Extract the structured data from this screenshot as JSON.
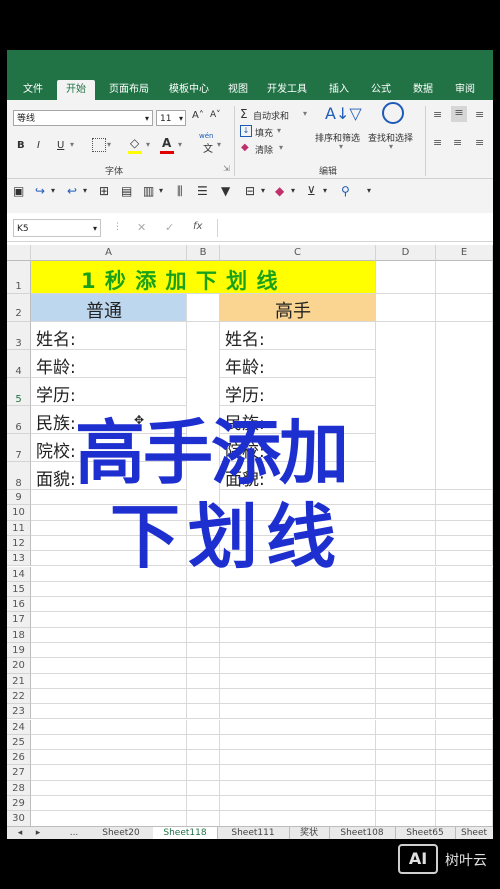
{
  "ribbon_tabs": [
    "文件",
    "开始",
    "页面布局",
    "模板中心",
    "视图",
    "开发工具",
    "插入",
    "公式",
    "数据",
    "审阅"
  ],
  "active_tab": "开始",
  "font": {
    "name": "等线",
    "size": "11",
    "grow": "A˄",
    "shrink": "A˅",
    "bold": "B",
    "italic": "I",
    "underline": "U",
    "group_label": "字体",
    "color_a": "A",
    "wen": "wén",
    "wen_char": "文"
  },
  "editing": {
    "autosum": "自动求和",
    "fill": "填充",
    "clear": "清除",
    "sort_filter": "排序和筛选",
    "find_select": "查找和选择",
    "group_label": "编辑"
  },
  "name_box": "K5",
  "formula_icons": {
    "cancel": "✕",
    "confirm": "✓",
    "fx": "fx"
  },
  "columns": [
    "A",
    "B",
    "C",
    "D",
    "E"
  ],
  "rows": [
    "1",
    "2",
    "3",
    "4",
    "5",
    "6",
    "7",
    "8",
    "9",
    "10",
    "11",
    "12",
    "13",
    "14",
    "15",
    "16",
    "17",
    "18",
    "19",
    "20",
    "21",
    "22",
    "23",
    "24",
    "25",
    "26",
    "27",
    "28",
    "29",
    "30"
  ],
  "cells": {
    "title": "1 秒 添 加  下 划 线",
    "normal_header": "普通",
    "expert_header": "高手",
    "labels_a": [
      "姓名:",
      "年龄:",
      "学历:",
      "民族:",
      "院校:",
      "面貌:"
    ],
    "labels_c": [
      "姓名:",
      "年龄:",
      "学历:",
      "民族:",
      "院校:",
      "面貌:"
    ]
  },
  "overlay": {
    "line1": "高手添加",
    "line2": "下划线"
  },
  "sheets": [
    "Sheet20",
    "Sheet118",
    "Sheet111",
    "奖状",
    "Sheet108",
    "Sheet65",
    "Sheet"
  ],
  "active_sheet": "Sheet118",
  "sheet_nav": {
    "prev": "◂",
    "next": "▸",
    "more": "..."
  },
  "watermark": {
    "logo": "AI",
    "text": "树叶云"
  },
  "colors": {
    "excel_green": "#217346",
    "title_bg": "#ffff00",
    "title_fg": "#1aa11a",
    "normal_bg": "#bdd7ee",
    "expert_bg": "#fad591",
    "overlay": "#1e2fd0"
  }
}
